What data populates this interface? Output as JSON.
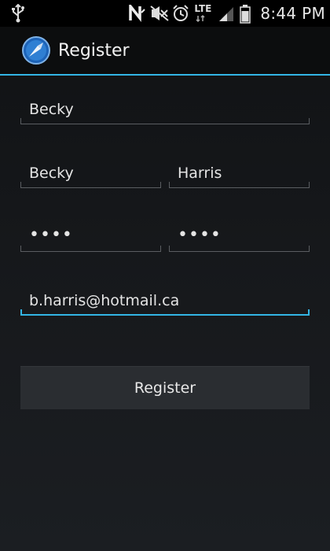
{
  "status_bar": {
    "time": "8:44 PM",
    "network_label": "LTE",
    "icons": [
      "usb-icon",
      "nfc-icon",
      "mute-icon",
      "alarm-icon",
      "lte-icon",
      "signal-icon",
      "battery-icon"
    ]
  },
  "action_bar": {
    "title": "Register",
    "accent_color": "#33b5e5"
  },
  "form": {
    "username": "Becky",
    "first_name": "Becky",
    "last_name": "Harris",
    "password": "••••",
    "confirm_password": "••••",
    "email": "b.harris@hotmail.ca",
    "register_label": "Register"
  }
}
